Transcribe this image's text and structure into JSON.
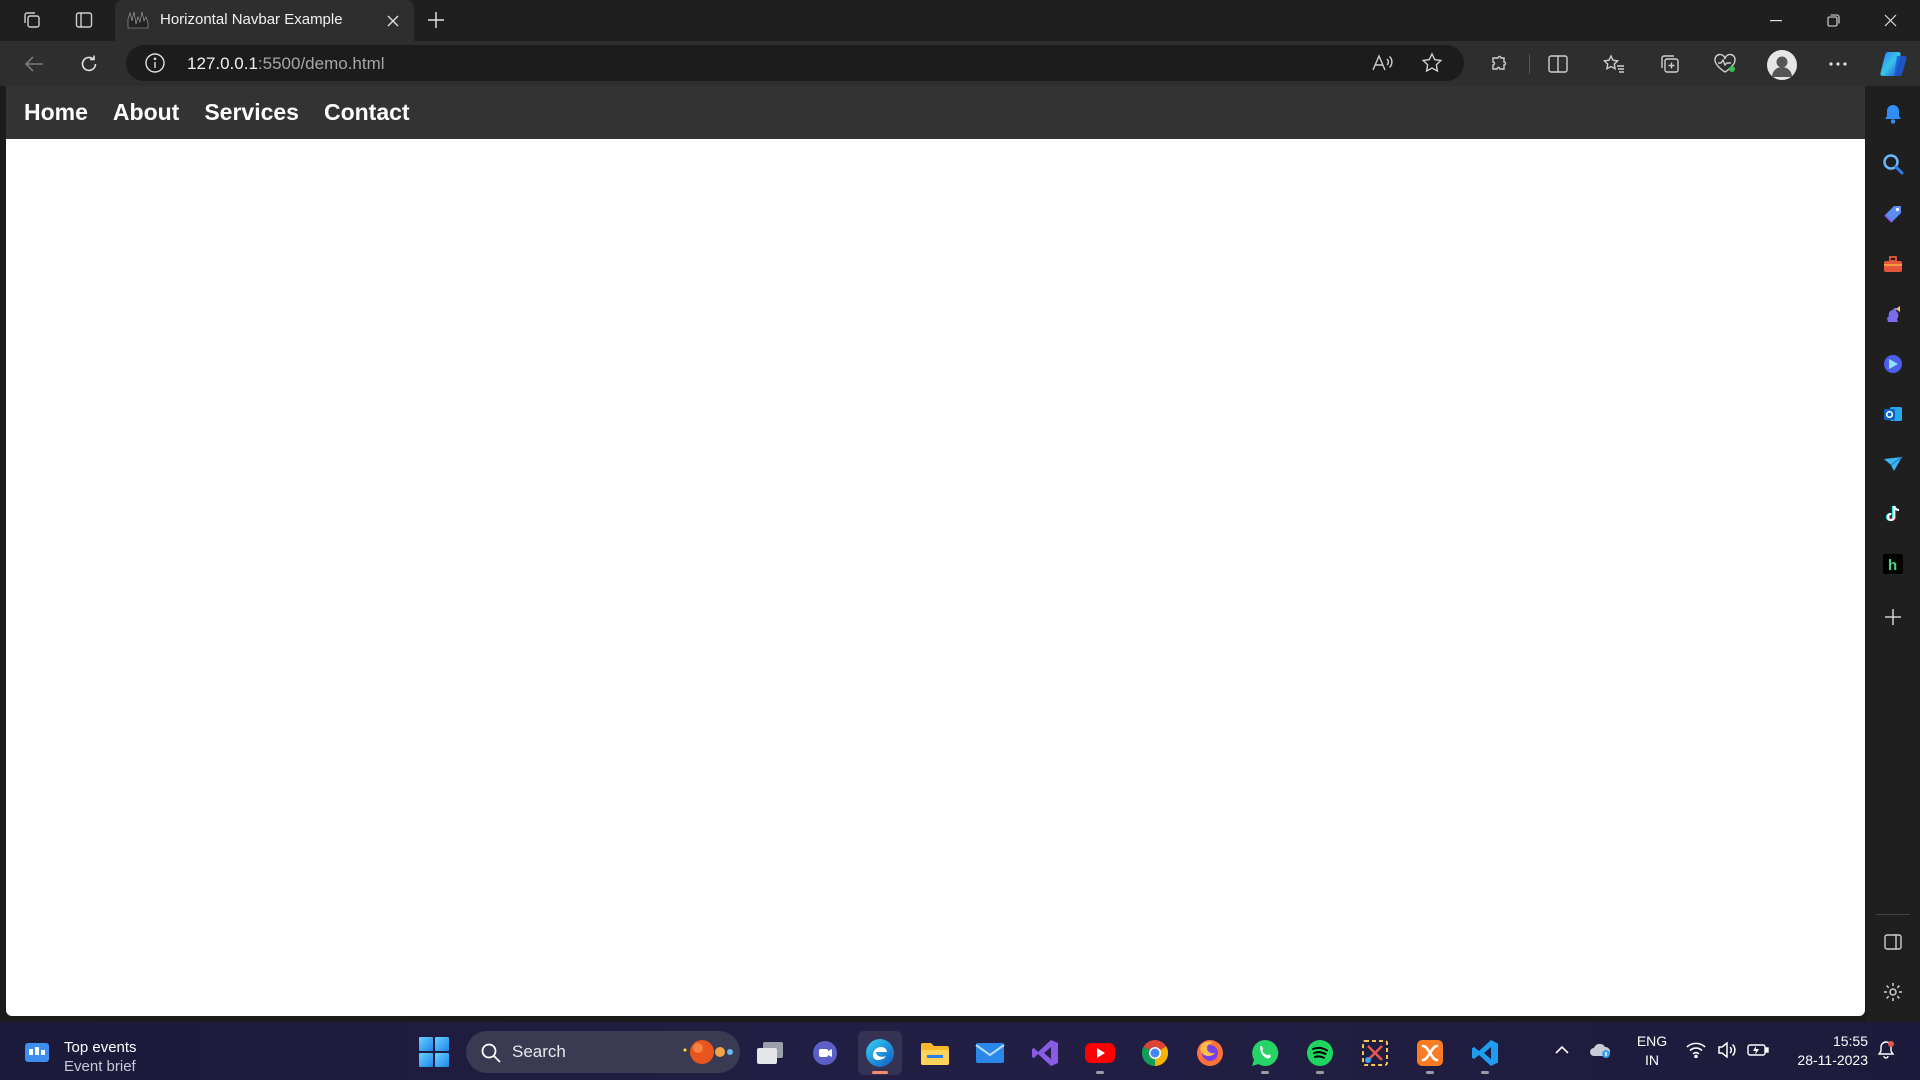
{
  "browser": {
    "tab": {
      "title": "Horizontal Navbar Example"
    },
    "address": {
      "host": "127.0.0.1",
      "rest": ":5500/demo.html"
    }
  },
  "page": {
    "nav": [
      {
        "label": "Home"
      },
      {
        "label": "About"
      },
      {
        "label": "Services"
      },
      {
        "label": "Contact"
      }
    ]
  },
  "sidebar": {
    "icons": [
      "bell-icon",
      "search-icon",
      "tag-icon",
      "toolbox-icon",
      "chess-icon",
      "copilot-icon",
      "outlook-icon",
      "paper-plane-icon",
      "tiktok-icon",
      "h-icon",
      "plus-icon"
    ]
  },
  "taskbar": {
    "widget": {
      "title": "Top events",
      "subtitle": "Event brief"
    },
    "search": {
      "placeholder": "Search"
    },
    "language": {
      "line1": "ENG",
      "line2": "IN"
    },
    "clock": {
      "time": "15:55",
      "date": "28-11-2023"
    }
  },
  "colors": {
    "navbar_bg": "#333333",
    "page_bg": "#ffffff",
    "chrome_bg": "#1f1f1f",
    "toolbar_bg": "#2e2e2e",
    "edge_accent": "#3ea6ff"
  }
}
